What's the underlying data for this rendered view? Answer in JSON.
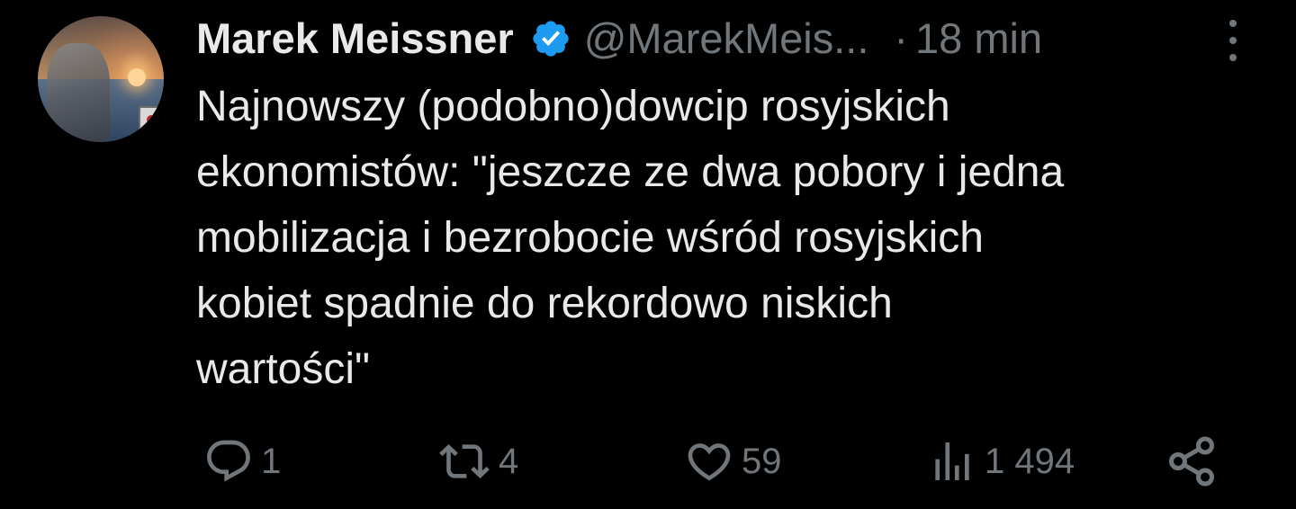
{
  "author": {
    "name": "Marek Meissner",
    "handle": "@MarekMeis...",
    "separator": "·",
    "time": "18 min",
    "verified": true
  },
  "tweet": {
    "text": "Najnowszy (podobno)dowcip rosyjskich\nekonomistów: \"jeszcze ze dwa pobory i jedna\nmobilizacja i bezrobocie wśród rosyjskich\nkobiet spadnie do rekordowo niskich\nwartości\""
  },
  "actions": {
    "replies": "1",
    "retweets": "4",
    "likes": "59",
    "views": "1 494"
  },
  "colors": {
    "background": "#000000",
    "text": "#e7e9ea",
    "muted": "#71767b",
    "verified": "#1d9bf0"
  },
  "icons": [
    "avatar",
    "verified-badge-icon",
    "more-icon",
    "reply-icon",
    "retweet-icon",
    "like-icon",
    "views-icon",
    "share-icon"
  ]
}
